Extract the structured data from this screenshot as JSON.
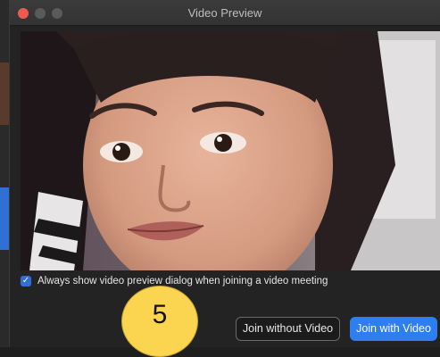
{
  "window": {
    "title": "Video Preview"
  },
  "preview": {
    "description_icon": "camera-feed"
  },
  "options": {
    "always_show_preview_label": "Always show video preview dialog when joining a video meeting",
    "always_show_preview_checked": true
  },
  "actions": {
    "join_without_video": "Join without Video",
    "join_with_video": "Join with Video"
  },
  "overlay": {
    "countdown": "5"
  },
  "colors": {
    "accent": "#2d7ff0",
    "close": "#ee5a52",
    "badge": "#fbd54f"
  }
}
